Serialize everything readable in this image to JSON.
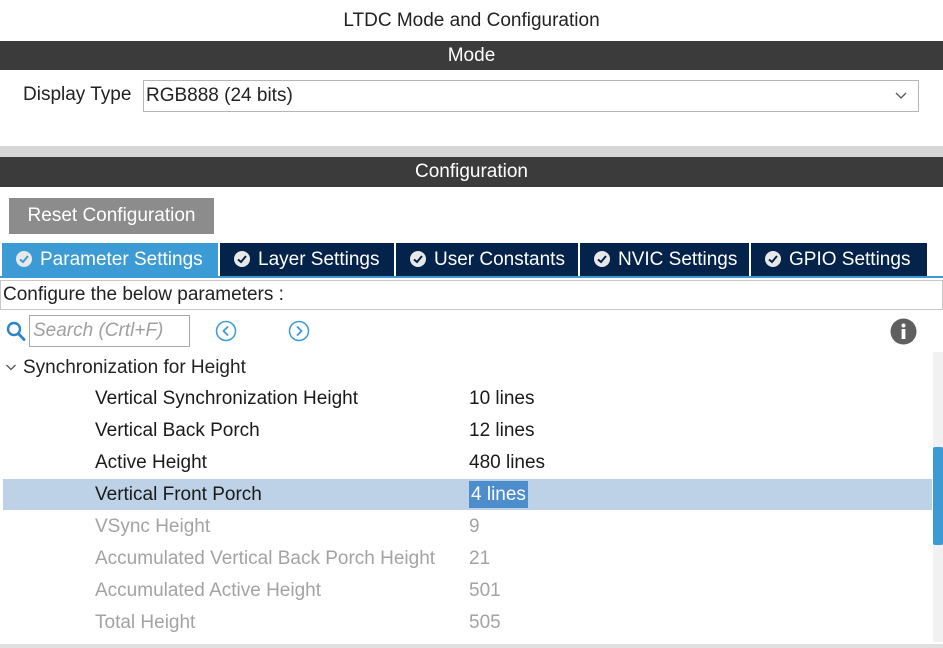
{
  "window": {
    "title": "LTDC Mode and Configuration"
  },
  "mode_section": {
    "header": "Mode",
    "display_type_label": "Display Type",
    "display_type_value": "RGB888 (24 bits)"
  },
  "config_section": {
    "header": "Configuration",
    "reset_label": "Reset Configuration",
    "tabs": [
      {
        "label": "Parameter Settings",
        "active": true
      },
      {
        "label": "Layer Settings",
        "active": false
      },
      {
        "label": "User Constants",
        "active": false
      },
      {
        "label": "NVIC Settings",
        "active": false
      },
      {
        "label": "GPIO Settings",
        "active": false
      }
    ],
    "configure_text": "Configure the below parameters :",
    "search_placeholder": "Search (Crtl+F)",
    "group_title": "Synchronization for Height",
    "rows": [
      {
        "name": "Vertical Synchronization Height",
        "value": "10 lines",
        "editable": true
      },
      {
        "name": "Vertical Back Porch",
        "value": "12 lines",
        "editable": true
      },
      {
        "name": "Active Height",
        "value": "480 lines",
        "editable": true
      },
      {
        "name": "Vertical Front Porch",
        "value": "4 lines",
        "editable": true,
        "selected": true
      },
      {
        "name": "VSync Height",
        "value": "9",
        "editable": false
      },
      {
        "name": "Accumulated Vertical Back Porch Height",
        "value": "21",
        "editable": false
      },
      {
        "name": "Accumulated Active Height",
        "value": "501",
        "editable": false
      },
      {
        "name": "Total Height",
        "value": "505",
        "editable": false
      }
    ]
  },
  "colors": {
    "section_bar": "#3b3b3b",
    "tab_active": "#3c9bd4",
    "tab_inactive": "#03234b",
    "selected_row": "#bdd1e7",
    "disabled_text": "#a3a3a3"
  },
  "icons": [
    "search-icon",
    "nav-prev-icon",
    "nav-next-icon",
    "info-icon",
    "check-circle-icon",
    "chevron-down-icon"
  ]
}
